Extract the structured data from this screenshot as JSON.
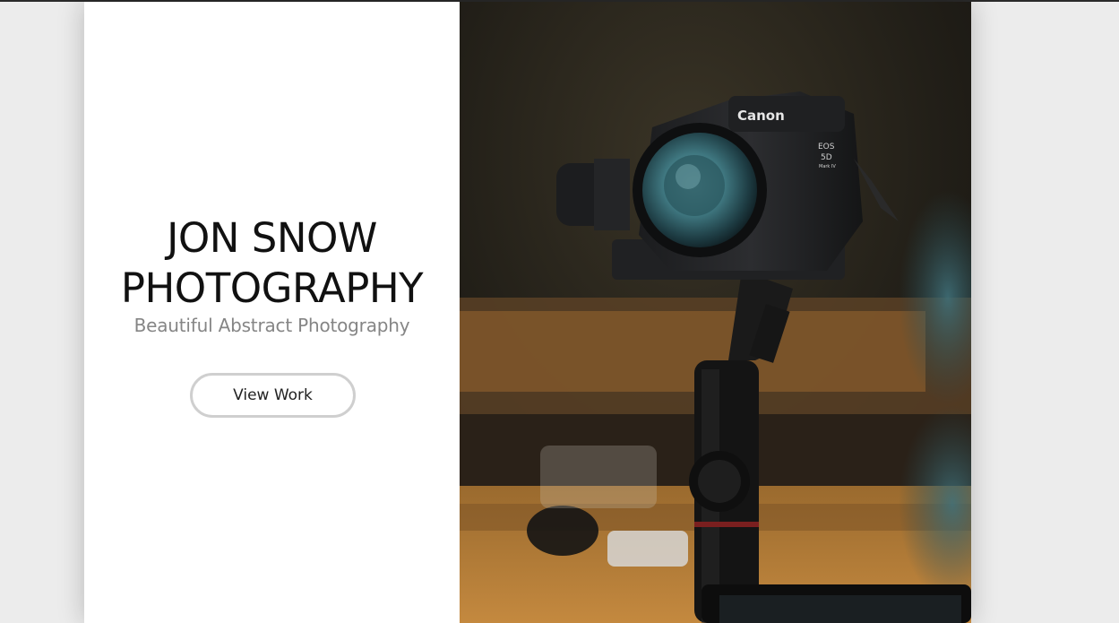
{
  "hero": {
    "title_line1": "JON SNOW",
    "title_line2": "PHOTOGRAPHY",
    "subtitle": "Beautiful Abstract Photography",
    "cta_label": "View Work"
  },
  "photo": {
    "brand_text": "Canon",
    "model_line1": "EOS",
    "model_line2": "5D",
    "model_line3": "Mark IV"
  }
}
